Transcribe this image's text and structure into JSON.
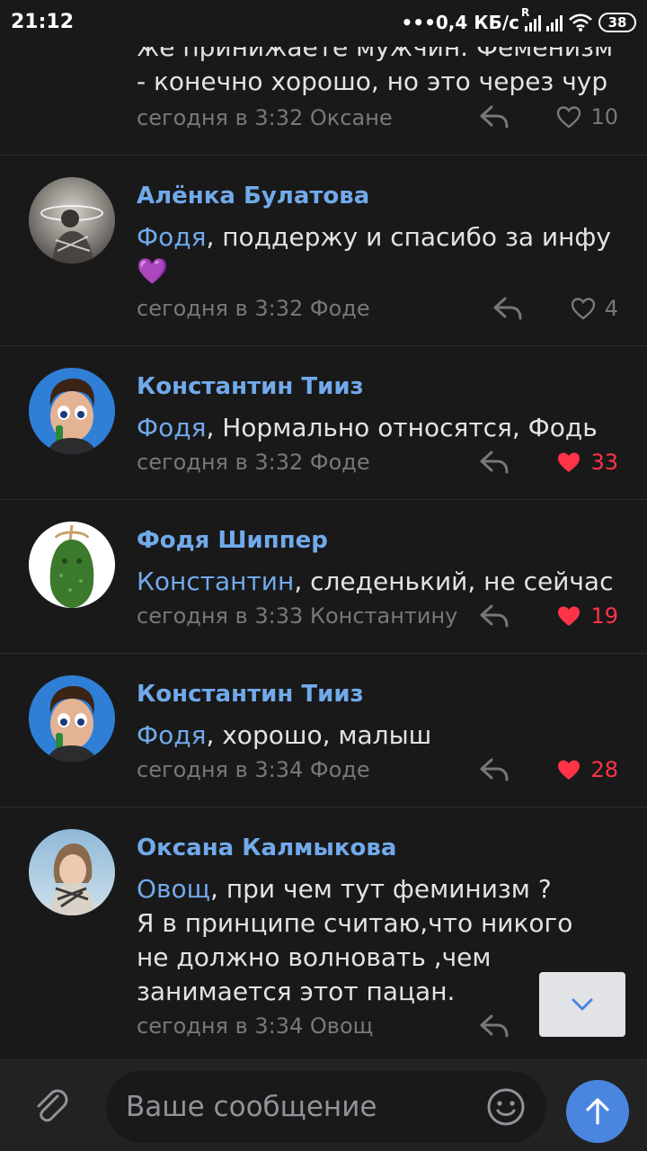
{
  "status_bar": {
    "time": "21:12",
    "network": "•••0,4 КБ/с",
    "roaming": "R",
    "battery": "38"
  },
  "comments": [
    {
      "text_lines": [
        "же принижаете мужчин. Феменизм",
        "- конечно хорошо, но это через чур"
      ],
      "meta": "сегодня в 3:32 Оксане",
      "likes": "10",
      "liked": false
    },
    {
      "author": "Алёнка Булатова",
      "mention": "Фодя",
      "text": ", поддержу и спасибо за инфу",
      "emoji": "💜",
      "meta": "сегодня в 3:32 Фоде",
      "likes": "4",
      "liked": false
    },
    {
      "author": "Константин Тииз",
      "mention": "Фодя",
      "text": ", Нормально относятся, Фодь",
      "meta": "сегодня в 3:32 Фоде",
      "likes": "33",
      "liked": true
    },
    {
      "author": "Фодя Шиппер",
      "mention": "Константин",
      "text": ", следенький, не сейчас",
      "meta": "сегодня в 3:33 Константину",
      "likes": "19",
      "liked": true
    },
    {
      "author": "Константин Тииз",
      "mention": "Фодя",
      "text": ", хорошо, малыш",
      "meta": "сегодня в 3:34 Фоде",
      "likes": "28",
      "liked": true
    },
    {
      "author": "Оксана Калмыкова",
      "mention": "Овощ",
      "text_lines": [
        ", при чем тут феминизм ?",
        "Я в принципе считаю,что никого",
        "не должно волновать ,чем",
        "занимается этот пацан."
      ],
      "meta": "сегодня в 3:34 Овощ"
    }
  ],
  "composer": {
    "placeholder": "Ваше сообщение"
  },
  "colors": {
    "background": "#19191a",
    "link": "#71aaeb",
    "like_active": "#ff3347",
    "send_button": "#4a86e0"
  },
  "icons": [
    "reply-icon",
    "heart-icon",
    "chevron-down-icon",
    "paperclip-icon",
    "smile-icon",
    "arrow-up-icon"
  ]
}
